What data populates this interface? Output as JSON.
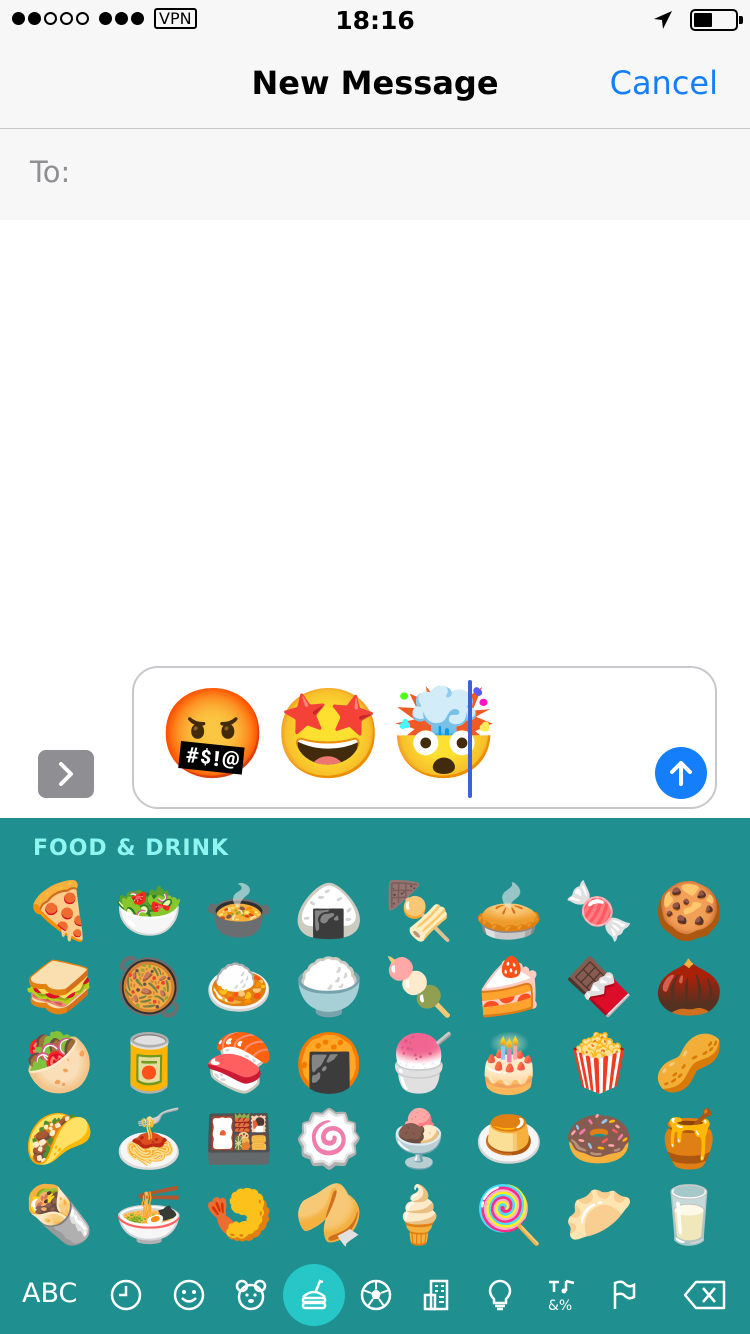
{
  "status": {
    "carrier": "VPN",
    "time": "18:16"
  },
  "nav": {
    "title": "New Message",
    "cancel": "Cancel"
  },
  "to": {
    "label": "To:"
  },
  "message": {
    "emojis": [
      "🤬",
      "🤩",
      "🤯"
    ]
  },
  "keyboard": {
    "category": "FOOD & DRINK",
    "emojis": [
      [
        "🍕",
        "🥗",
        "🍲",
        "🍙",
        "🍢",
        "🥧",
        "🍬",
        "🍪"
      ],
      [
        "🥪",
        "🥘",
        "🍛",
        "🍚",
        "🍡",
        "🍰",
        "🍫",
        "🌰"
      ],
      [
        "🥙",
        "🥫",
        "🍣",
        "🍘",
        "🍧",
        "🎂",
        "🍿",
        "🥜"
      ],
      [
        "🌮",
        "🍝",
        "🍱",
        "🍥",
        "🍨",
        "🍮",
        "🍩",
        "🍯"
      ],
      [
        "🌯",
        "🍜",
        "🍤",
        "🥠",
        "🍦",
        "🍭",
        "🥟",
        "🥛"
      ]
    ],
    "abc": "ABC",
    "tools": [
      "clock-icon",
      "smiley-icon",
      "bear-icon",
      "food-icon",
      "ball-icon",
      "building-icon",
      "bulb-icon",
      "symbols-icon",
      "flag-icon",
      "backspace-icon"
    ]
  },
  "colors": {
    "accent": "#147efb",
    "keyboard_bg": "#1f8f8f",
    "category_text": "#8ff5f0"
  }
}
